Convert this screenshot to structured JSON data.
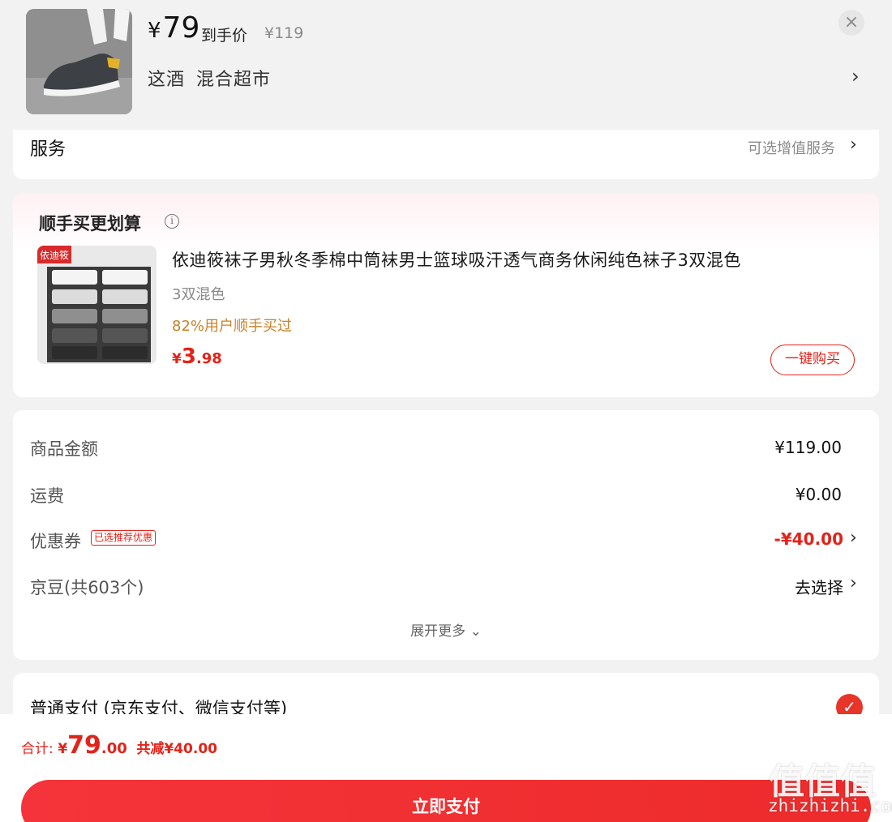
{
  "product": {
    "image_icon": "sneaker-photo",
    "price_symbol": "¥",
    "price": "79",
    "price_label": "到手价",
    "original_price": "¥119",
    "spec_color": "这酒",
    "spec_variant": "混合超市",
    "close_icon": "×",
    "chevron": "›"
  },
  "service": {
    "title": "服务",
    "hint": "可选增值服务",
    "chevron": "›"
  },
  "addon": {
    "section_title": "顺手买更划算",
    "info_icon": "i",
    "item_title": "依迪筱袜子男秋冬季棉中筒袜男士篮球吸汗透气商务休闲纯色袜子3双混色",
    "sku": "3双混色",
    "purchase_rate": "82%用户顺手买过",
    "price_symbol": "¥",
    "price_int": "3",
    "price_dec": ".98",
    "buy_button": "一键购买",
    "image_brand": "依迪筱"
  },
  "fees": {
    "goods_label": "商品金额",
    "goods_value": "¥119.00",
    "shipping_label": "运费",
    "shipping_value": "¥0.00",
    "coupon_label": "优惠券",
    "coupon_badge": "已选推荐优惠",
    "coupon_value": "-¥40.00",
    "beans_label": "京豆(共603个)",
    "beans_value": "去选择",
    "chevron": "›",
    "expand_label": "展开更多 ⌄"
  },
  "payment": {
    "method_label": "普通支付 (京东支付、微信支付等)",
    "check_icon": "✓"
  },
  "footer": {
    "total_label": "合计:",
    "total_symbol": "¥",
    "total_int": "79",
    "total_dec": ".00",
    "saving": "共减¥40.00",
    "pay_button": "立即支付"
  },
  "watermark": {
    "big": "值值值",
    "small": "zhizhizhi.com"
  },
  "colors": {
    "accent_red": "#e2231a",
    "rate_orange": "#c8822a"
  }
}
